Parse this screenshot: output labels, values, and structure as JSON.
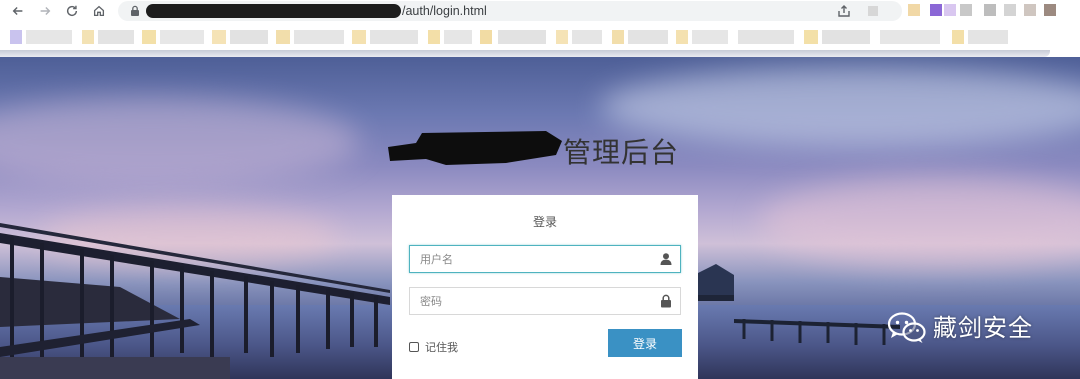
{
  "browser": {
    "url_suffix": "/auth/login.html"
  },
  "page": {
    "brand_suffix": "管理后台",
    "card_title": "登录",
    "username_placeholder": "用户名",
    "password_placeholder": "密码",
    "remember_label": "记住我",
    "login_button": "登录"
  },
  "watermark": {
    "text": "藏剑安全"
  },
  "colors": {
    "accent": "#3a91c4",
    "focus_border": "#4fb3bf"
  },
  "icons": [
    "back-icon",
    "forward-icon",
    "reload-icon",
    "home-icon",
    "lock-icon",
    "share-icon",
    "user-icon",
    "padlock-icon",
    "wechat-icon"
  ]
}
